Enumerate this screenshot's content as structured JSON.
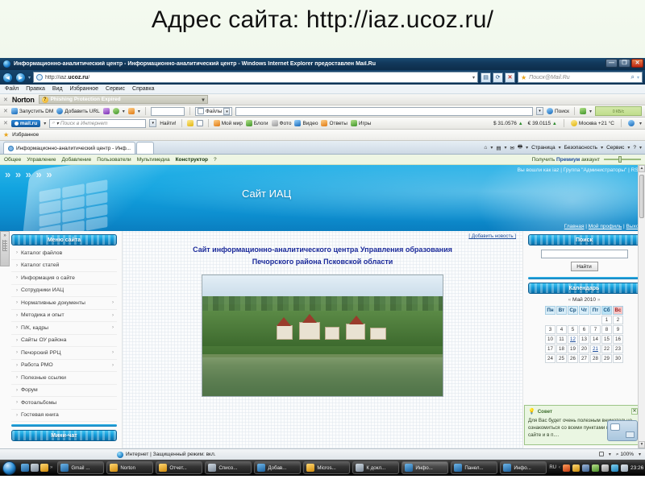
{
  "slide": {
    "title": "Адрес сайта: http://iaz.ucoz.ru/"
  },
  "browser": {
    "title": "Информационно-аналитический центр - Информационно-аналитический центр - Windows Internet Explorer предоставлен Mail.Ru",
    "window_buttons": {
      "minimize": "—",
      "maximize": "❐",
      "close": "✕"
    },
    "address": {
      "url_prefix": "http://iaz.",
      "url_bold": "ucoz.ru",
      "url_suffix": "/",
      "dropdown": "▾"
    },
    "address_icons": {
      "refresh": "⟳",
      "stop": "✕",
      "feed": "▤"
    },
    "search": {
      "placeholder": "Поиск@Mail.Ru",
      "magnifier": "🔍",
      "dropdown": "▾"
    },
    "menu": [
      "Файл",
      "Правка",
      "Вид",
      "Избранное",
      "Сервис",
      "Справка"
    ],
    "norton": {
      "close": "✕",
      "logo": "Norton",
      "badge": "?",
      "status": "Phishing Protection Expired",
      "dropdown": "▾"
    },
    "dm_toolbar": {
      "close": "✕",
      "start_dm": "Запустить DM",
      "add_url": "Добавить URL",
      "files_label": "Файлы",
      "search_label": "Поиск",
      "meter": "0 КБ/с"
    },
    "mail_toolbar": {
      "close": "✕",
      "logo": "mail.ru",
      "search_placeholder": "Поиск в Интернет",
      "find_button": "Найти!",
      "links": [
        "Мой мир",
        "Блоги",
        "Фото",
        "Видео",
        "Ответы",
        "Игры"
      ],
      "usd": "$ 31.0576",
      "eur": "€ 39.0115",
      "weather": "Москва +21 °C",
      "up_arrow": "▲"
    },
    "favorites": {
      "label": "Избранное"
    },
    "tabs": [
      {
        "label": "Информационно-аналитический центр - Инф...",
        "active": true
      },
      {
        "label": "",
        "active": false
      }
    ],
    "command_bar": [
      "Страница",
      "Безопасность",
      "Сервис"
    ],
    "status": {
      "zone": "Интернет | Защищенный режим: вкл.",
      "zoom": "100%",
      "zoom_caret": "▾"
    }
  },
  "ucoz_admin": {
    "items": [
      "Общее",
      "Управление",
      "Добавление",
      "Пользователи",
      "Мультимедиа",
      "Конструктор",
      "?"
    ],
    "bold_item": "Конструктор",
    "premium_prefix": "Получить ",
    "premium_bold": "Премиум",
    "premium_suffix": " аккаунт"
  },
  "site": {
    "banner_title": "Сайт ИАЦ",
    "chevrons": "» » » » »",
    "login_line": "Вы вошли как iaz | Группа \"Администраторы\" | RSS",
    "nav_links": [
      "Главная",
      "Мой профиль",
      "Выход"
    ],
    "add_news": "[ Добавить новость ]",
    "page_title_line1": "Сайт информационно-аналитического центра Управления образования",
    "page_title_line2": "Печорского района Псковской области",
    "left_block": {
      "header": "Меню сайта",
      "items": [
        {
          "label": "Каталог файлов",
          "submenu": false
        },
        {
          "label": "Каталог статей",
          "submenu": false
        },
        {
          "label": "Информация о сайте",
          "submenu": false
        },
        {
          "label": "Сотрудники ИАЦ",
          "submenu": false
        },
        {
          "label": "Нормативные документы",
          "submenu": true
        },
        {
          "label": "Методика и опыт",
          "submenu": true
        },
        {
          "label": "П/К, кадры",
          "submenu": true
        },
        {
          "label": "Сайты ОУ района",
          "submenu": false
        },
        {
          "label": "Печорский РРЦ",
          "submenu": true
        },
        {
          "label": "Работа РМО",
          "submenu": true
        },
        {
          "label": "Полезные ссылки",
          "submenu": false
        },
        {
          "label": "Форум",
          "submenu": false
        },
        {
          "label": "Фотоальбомы",
          "submenu": false
        },
        {
          "label": "Гостевая книга",
          "submenu": false
        }
      ],
      "footer_header": "Мини-чат"
    },
    "search_block": {
      "header": "Поиск",
      "input_value": "",
      "button": "Найти"
    },
    "calendar_block": {
      "header": "Календарь",
      "prev": "«",
      "next": "»",
      "month": "Май 2010",
      "weekdays": [
        "Пн",
        "Вт",
        "Ср",
        "Чт",
        "Пт",
        "Сб",
        "Вс"
      ],
      "weeks": [
        [
          "",
          "",
          "",
          "",
          "",
          "1",
          "2"
        ],
        [
          "3",
          "4",
          "5",
          "6",
          "7",
          "8",
          "9"
        ],
        [
          "10",
          "11",
          "12",
          "13",
          "14",
          "15",
          "16"
        ],
        [
          "17",
          "18",
          "19",
          "20",
          "21",
          "22",
          "23"
        ],
        [
          "24",
          "25",
          "26",
          "27",
          "28",
          "29",
          "30"
        ]
      ],
      "linked_days": [
        "12",
        "21"
      ]
    },
    "tip": {
      "icon": "bulb-icon",
      "title": "Совет",
      "close": "✕",
      "text": "Для Вас будет очень полезным внимательно ознакомиться со всеми пунктами меню на сайте и в п...."
    }
  },
  "taskbar": {
    "start": "start-orb",
    "quick_dots": "»",
    "buttons": [
      "Gmail ...",
      "Norton",
      "Отчет...",
      "Списо...",
      "Добав...",
      "Micros...",
      "К докл...",
      "Инфо...",
      "Панел...",
      "Инфо..."
    ],
    "active_button": "Инфо...",
    "lang": "RU",
    "clock": "23:26"
  },
  "colors": {
    "banner_blue": "#12a4e0",
    "title_navy": "#1b2a9a",
    "panel_header": "#149ad8",
    "slide_bg": "#e8f3e2"
  }
}
